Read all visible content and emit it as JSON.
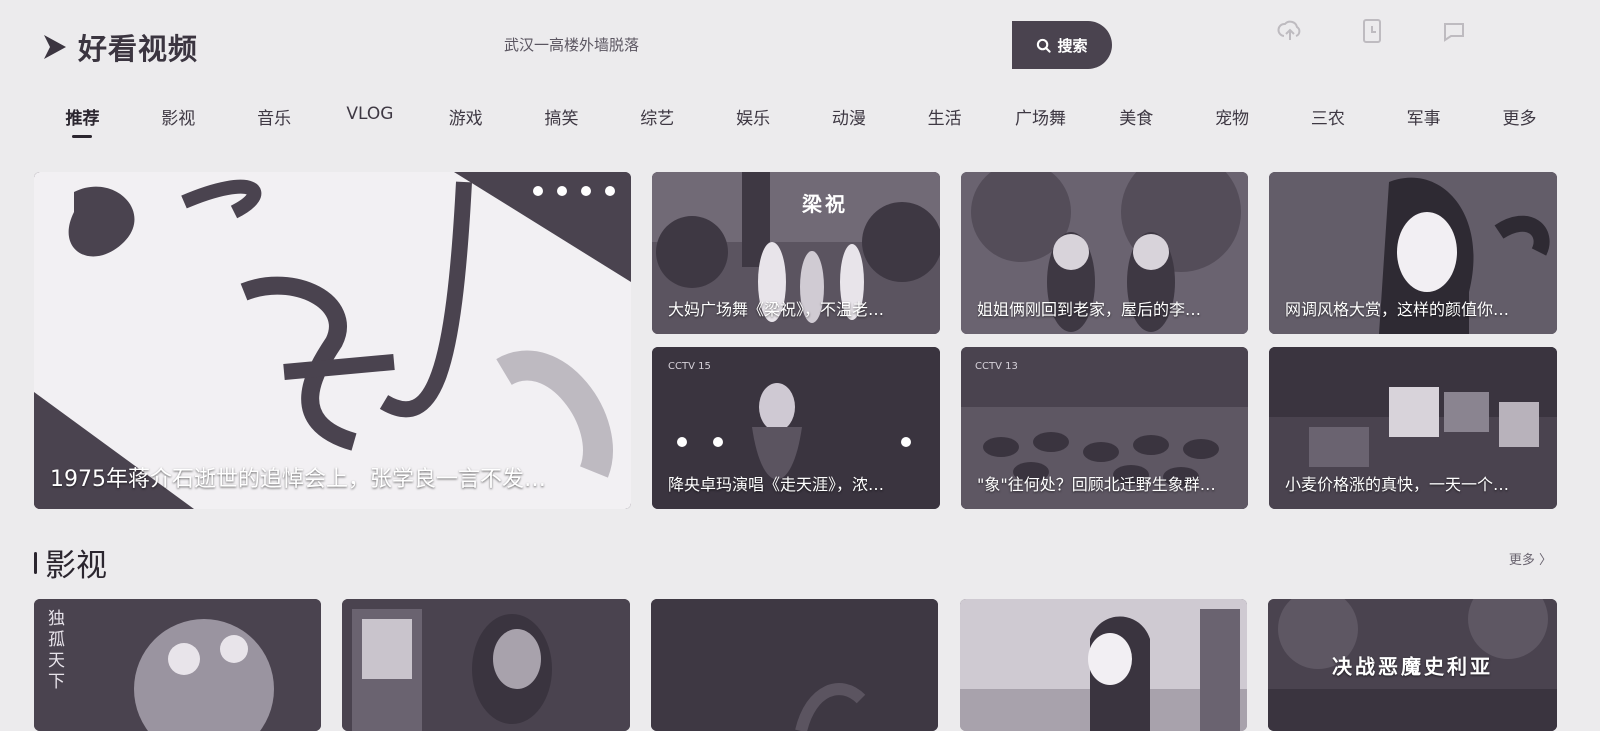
{
  "brand": {
    "logo_text": "好看视频"
  },
  "search": {
    "placeholder": "武汉一高楼外墙脱落",
    "button_label": "搜索"
  },
  "header_tools": [
    {
      "icon": "upload-icon",
      "label": ""
    },
    {
      "icon": "history-icon",
      "label": ""
    },
    {
      "icon": "message-icon",
      "label": ""
    }
  ],
  "nav": {
    "items": [
      "推荐",
      "影视",
      "音乐",
      "VLOG",
      "游戏",
      "搞笑",
      "综艺",
      "娱乐",
      "动漫",
      "生活",
      "广场舞",
      "美食",
      "宠物",
      "三农",
      "军事",
      "更多"
    ],
    "active": "推荐"
  },
  "featured": {
    "title": "1975年蒋介石逝世的追悼会上，张学良一言不发…"
  },
  "grid": [
    {
      "title": "大妈广场舞《梁祝》，不温老…",
      "overlay": "梁祝"
    },
    {
      "title": "姐姐俩刚回到老家，屋后的李…"
    },
    {
      "title": "网调风格大赏，这样的颜值你…"
    },
    {
      "title": "降央卓玛演唱《走天涯》，浓…"
    },
    {
      "title": "\"象\"往何处？回顾北迁野生象群…"
    },
    {
      "title": "小麦价格涨的真快，一天一个…"
    }
  ],
  "section": {
    "title": "影视",
    "more_label": "更多 〉",
    "cards": [
      {
        "overlay": "独孤天下"
      },
      {
        "overlay": ""
      },
      {
        "overlay": ""
      },
      {
        "overlay": ""
      },
      {
        "overlay": "决战恶魔史利亚"
      }
    ]
  },
  "colors": {
    "brand_dark": "#4a434f",
    "page_bg": "#ecebed",
    "text_dark": "#2b262f"
  }
}
